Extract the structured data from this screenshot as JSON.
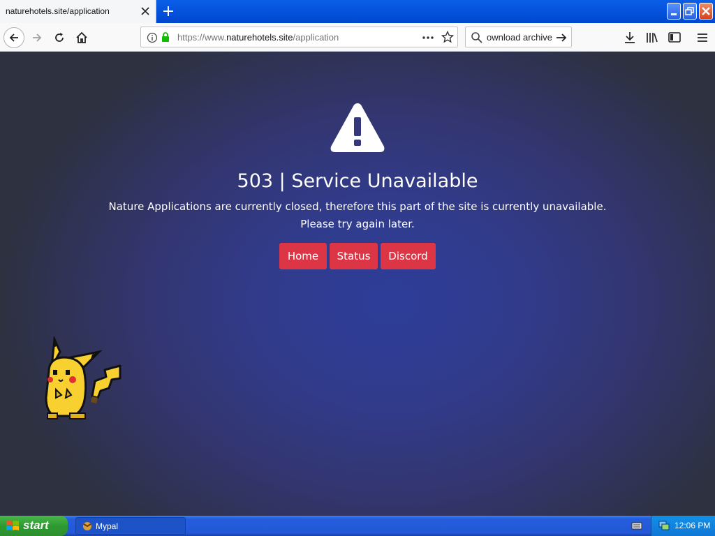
{
  "browser": {
    "tab_title": "naturehotels.site/application",
    "url_prefix": "https://www.",
    "url_domain": "naturehotels.site",
    "url_path": "/application",
    "search_value": "ownload archive"
  },
  "page": {
    "heading": "503 | Service Unavailable",
    "message_line1": "Nature Applications are currently closed, therefore this part of the site is currently unavailable.",
    "message_line2": "Please try again later.",
    "buttons": {
      "home": "Home",
      "status": "Status",
      "discord": "Discord"
    },
    "accent_color": "#dc3545"
  },
  "taskbar": {
    "start_label": "start",
    "task_label": "Mypal",
    "clock": "12:06 PM"
  }
}
